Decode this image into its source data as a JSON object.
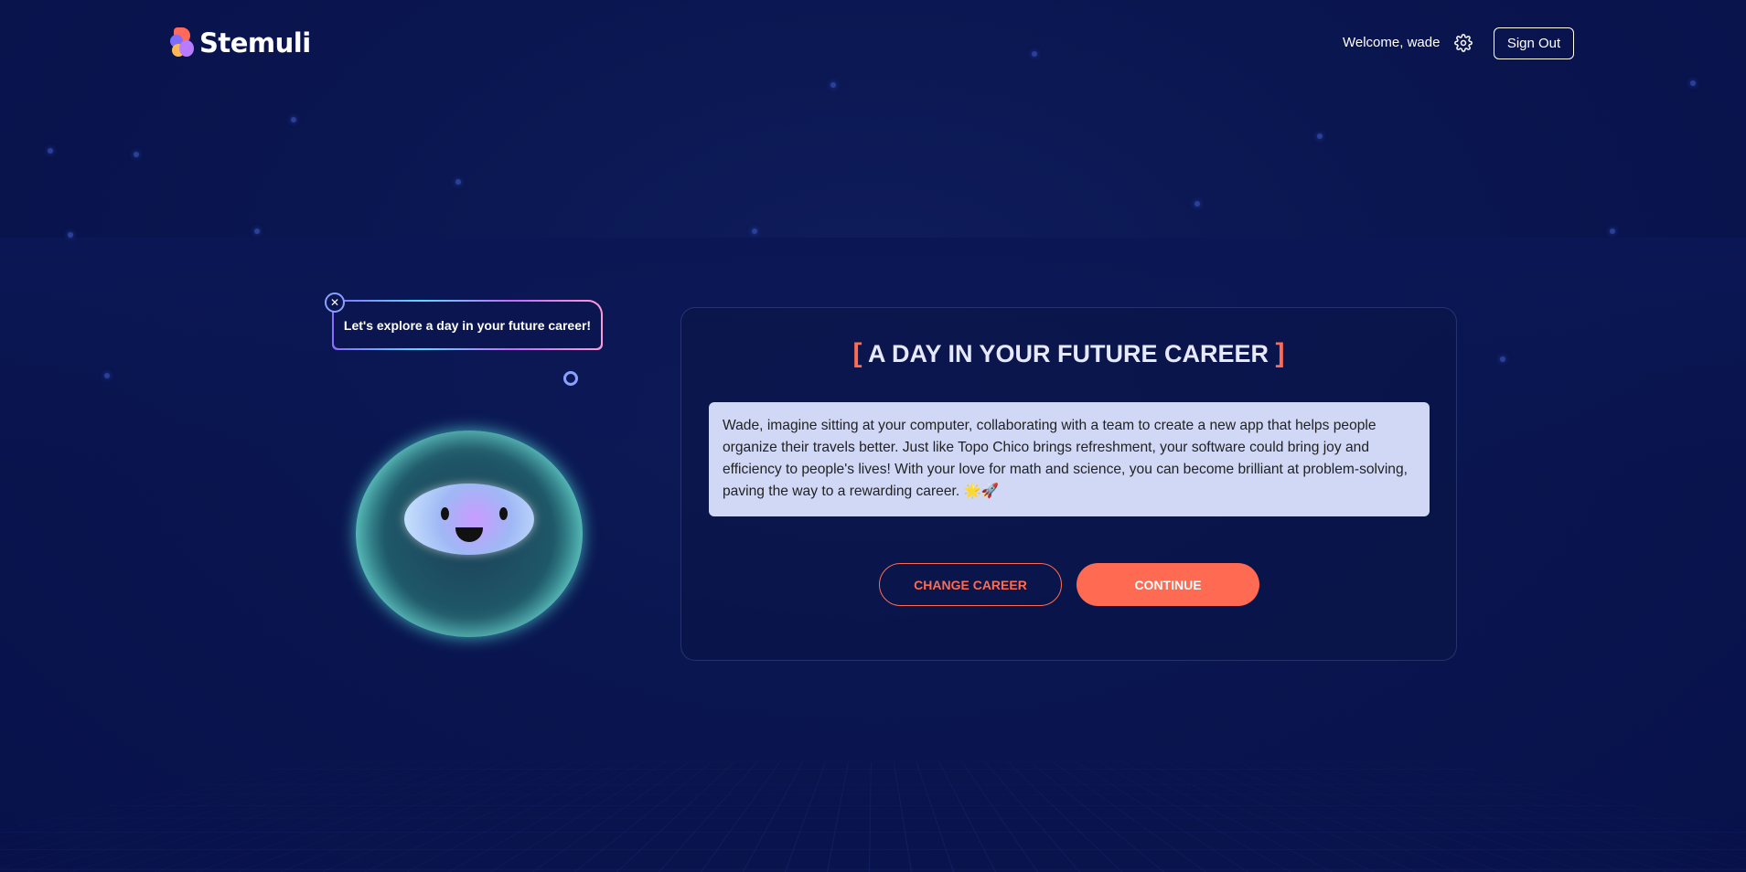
{
  "header": {
    "logo_text": "Stemuli",
    "welcome_text": "Welcome, wade",
    "sign_out_label": "Sign Out",
    "settings_icon": "gear-icon"
  },
  "guide": {
    "bubble_text": "Let's explore a day in your future career!",
    "close_icon": "close-icon"
  },
  "card": {
    "title": "A DAY IN YOUR FUTURE CAREER",
    "body": "Wade, imagine sitting at your computer, collaborating with a team to create a new app that helps people organize their travels better. Just like Topo Chico brings refreshment, your software could bring joy and efficiency to people's lives! With your love for math and science, you can become brilliant at problem-solving, paving the way to a rewarding career. 🌟🚀",
    "change_label": "CHANGE CAREER",
    "continue_label": "CONTINUE"
  },
  "colors": {
    "accent": "#ff6b52",
    "background": "#0a1650",
    "text_box": "#d0d8f6"
  }
}
